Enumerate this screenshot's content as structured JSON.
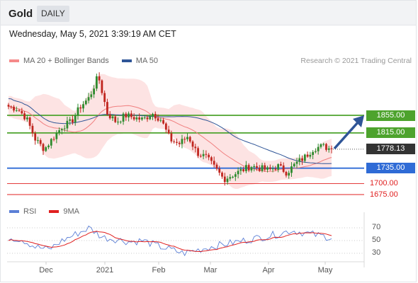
{
  "header": {
    "title": "Gold",
    "period": "DAILY"
  },
  "timestamp": "Wednesday, May 5, 2021 3:39:19 AM CET",
  "credit": "Research © 2021 Trading Central",
  "legend": [
    {
      "label": "MA 20 + Bollinger Bands",
      "color": "#f58a8a"
    },
    {
      "label": "MA 50",
      "color": "#2f5597"
    }
  ],
  "ind_legend": [
    {
      "label": "RSI",
      "color": "#5b7fd6"
    },
    {
      "label": "9MA",
      "color": "#e02020"
    }
  ],
  "levels": [
    {
      "value": 1855.0,
      "label": "1855.00",
      "kind": "resistance",
      "color": "#4da32d"
    },
    {
      "value": 1815.0,
      "label": "1815.00",
      "kind": "resistance",
      "color": "#4da32d"
    },
    {
      "value": 1778.13,
      "label": "1778.13",
      "kind": "last",
      "color": "#333333"
    },
    {
      "value": 1735.0,
      "label": "1735.00",
      "kind": "pivot",
      "color": "#2f6bd6"
    },
    {
      "value": 1700.0,
      "label": "1700.00",
      "kind": "support",
      "color": "#e02020"
    },
    {
      "value": 1675.0,
      "label": "1675.00",
      "kind": "support",
      "color": "#e02020"
    }
  ],
  "x_ticks": [
    "Dec",
    "2021",
    "Feb",
    "Mar",
    "Apr",
    "May"
  ],
  "rsi_ticks": [
    "70",
    "50",
    "30"
  ],
  "chart_data": {
    "type": "candlestick",
    "instrument": "Gold",
    "timeframe": "Daily",
    "x_labels": [
      "Dec",
      "2021",
      "Feb",
      "Mar",
      "Apr",
      "May"
    ],
    "price_keypoints": [
      1875,
      1870,
      1848,
      1800,
      1778,
      1805,
      1830,
      1840,
      1875,
      1895,
      1945,
      1860,
      1840,
      1855,
      1850,
      1845,
      1860,
      1845,
      1800,
      1790,
      1808,
      1770,
      1760,
      1735,
      1710,
      1720,
      1730,
      1740,
      1735,
      1730,
      1740,
      1725,
      1745,
      1760,
      1780,
      1785,
      1778
    ],
    "levels": [
      1855.0,
      1815.0,
      1778.13,
      1735.0,
      1700.0,
      1675.0
    ],
    "rsi_keypoints": [
      55,
      52,
      40,
      36,
      50,
      60,
      70,
      55,
      52,
      48,
      50,
      42,
      36,
      30,
      35,
      40,
      44,
      48,
      52,
      56,
      60,
      66,
      62,
      58,
      55
    ],
    "rsi_levels": [
      70,
      50,
      30
    ]
  }
}
